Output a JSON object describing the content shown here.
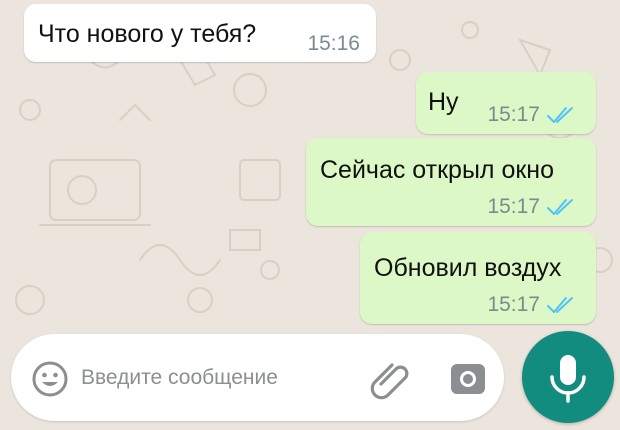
{
  "chat": {
    "messages": [
      {
        "direction": "incoming",
        "text": "Что нового у тебя?",
        "time": "15:16"
      },
      {
        "direction": "outgoing",
        "text": "Ну",
        "time": "15:17",
        "status": "read"
      },
      {
        "direction": "outgoing",
        "text": "Сейчас открыл окно",
        "time": "15:17",
        "status": "read"
      },
      {
        "direction": "outgoing",
        "text": "Обновил воздух",
        "time": "15:17",
        "status": "read"
      }
    ]
  },
  "composer": {
    "placeholder": "Введите сообщение",
    "emoji_icon": "emoji-icon",
    "attach_icon": "paperclip-icon",
    "camera_icon": "camera-icon",
    "mic_icon": "microphone-icon"
  },
  "colors": {
    "wallpaper": "#ece5dd",
    "incoming_bubble": "#ffffff",
    "outgoing_bubble": "#dcf8c6",
    "read_ticks": "#4fc3f7",
    "mic_button": "#128c7e"
  }
}
